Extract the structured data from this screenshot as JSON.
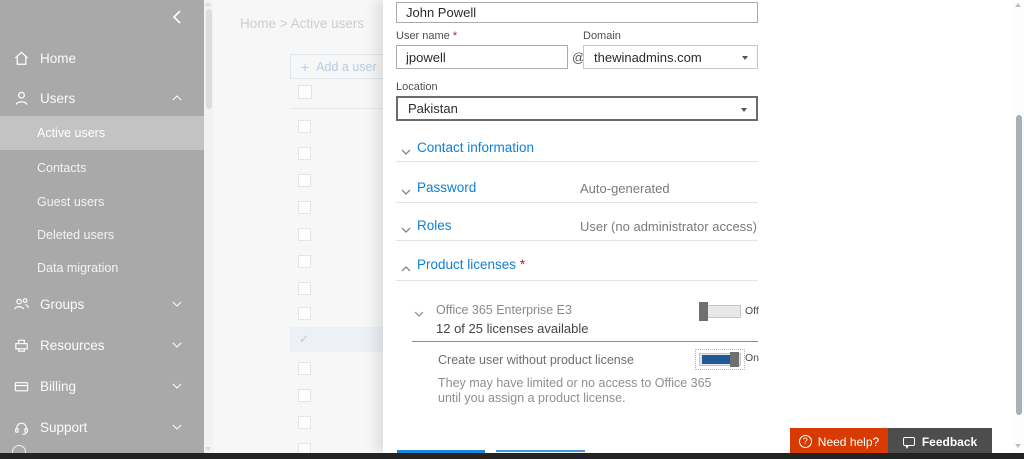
{
  "colors": {
    "link_blue": "#107fd5",
    "toggle_blue": "#1f5a96",
    "need_help_orange": "#d83b01",
    "feedback_gray": "#4d4d4d"
  },
  "sidebar": {
    "items": {
      "home": "Home",
      "users": "Users",
      "groups": "Groups",
      "resources": "Resources",
      "billing": "Billing",
      "support": "Support"
    },
    "sub_items": [
      {
        "label": "Active users"
      },
      {
        "label": "Contacts"
      },
      {
        "label": "Guest users"
      },
      {
        "label": "Deleted users"
      },
      {
        "label": "Data migration"
      }
    ]
  },
  "page": {
    "breadcrumb": "Home > Active users",
    "plus": "+",
    "add_user_label": "Add a user"
  },
  "panel": {
    "display_name_value": "John Powell",
    "username_label": "User name ",
    "required_mark": "*",
    "username_value": "jpowell",
    "at_symbol": "@",
    "domain_label": "Domain",
    "domain_value": "thewinadmins.com",
    "location_label": "Location",
    "location_value": "Pakistan",
    "sections": [
      {
        "label": "Contact information",
        "value": ""
      },
      {
        "label": "Password",
        "value": "Auto-generated"
      },
      {
        "label": "Roles",
        "value": "User (no administrator access)"
      },
      {
        "label": "Product licenses ",
        "value": ""
      }
    ],
    "license": {
      "name": "Office 365 Enterprise E3",
      "availability": "12 of 25 licenses available",
      "off_label": "Off",
      "create_without_label": "Create user without product license",
      "on_label": "On",
      "note_line1": "They may have limited or no access to Office 365",
      "note_line2": "until you assign a product license."
    }
  },
  "footer": {
    "help_icon_text": "?",
    "need_help": "Need help?",
    "feedback": "Feedback"
  },
  "glyphs": {
    "checkmark": "✓"
  }
}
